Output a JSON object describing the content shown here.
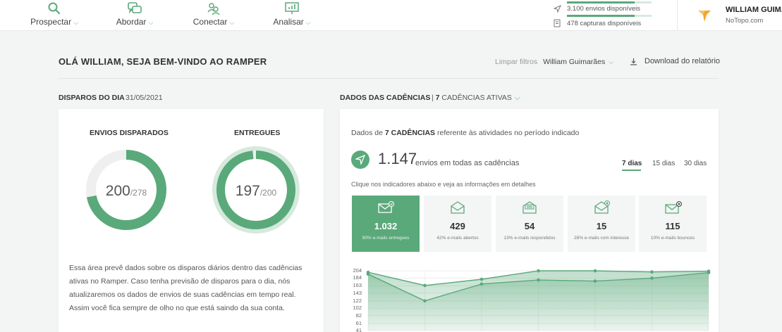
{
  "nav": {
    "items": [
      {
        "label": "Prospectar",
        "icon": "search-icon"
      },
      {
        "label": "Abordar",
        "icon": "chat-icon"
      },
      {
        "label": "Conectar",
        "icon": "people-icon"
      },
      {
        "label": "Analisar",
        "icon": "presentation-chart-icon"
      }
    ]
  },
  "quota": {
    "sends": {
      "text": "3.100 envios disponíveis",
      "icon": "send-icon",
      "fill": 0.8
    },
    "captures": {
      "text": "478 capturas disponíveis",
      "icon": "document-icon",
      "fill": 0.8
    }
  },
  "user": {
    "name": "WILLIAM GUIMA",
    "company": "NoTopo.com"
  },
  "header": {
    "welcome": "OLÁ WILLIAM, SEJA BEM-VINDO AO RAMPER",
    "clear_filters": "Limpar filtros",
    "user_filter": "William Guimarães",
    "download": "Download do relatório"
  },
  "daily": {
    "title": "DISPAROS DO DIA",
    "date": "31/05/2021",
    "fired": {
      "label": "ENVIOS DISPARADOS",
      "value": "200",
      "total": "/278",
      "fraction": 0.7194
    },
    "delivered": {
      "label": "ENTREGUES",
      "value": "197",
      "total": "/200",
      "fraction": 0.985
    },
    "description": "Essa área prevê dados sobre os disparos diários dentro das cadências ativas no Ramper. Caso tenha previsão de disparos para o dia, nós atualizaremos os dados de envios de suas cadências em tempo real. Assim você fica sempre de olho no que está saindo da sua conta."
  },
  "cadences": {
    "title": "DADOS DAS CADÊNCIAS",
    "separator": "|",
    "active_count": "7",
    "active_label": "CADÊNCIAS ATIVAS",
    "intro_prefix": "Dados de ",
    "intro_bold": "7 CADÊNCIAS",
    "intro_suffix": " referente às atividades no período indicado",
    "total": "1.147",
    "total_label": "envios em todas as cadências",
    "periods": [
      "7 dias",
      "15 dias",
      "30 dias"
    ],
    "active_period": "7 dias",
    "hint": "Clique nos indicadores abaixo e veja as informações em detalhes",
    "indicators": [
      {
        "icon": "mail-check-icon",
        "value": "1.032",
        "caption": "90% e-mails entregues",
        "active": true
      },
      {
        "icon": "mail-open-icon",
        "value": "429",
        "caption": "42% e-mails abertos",
        "active": false
      },
      {
        "icon": "mail-reply-icon",
        "value": "54",
        "caption": "13% e-mails respondidos",
        "active": false
      },
      {
        "icon": "mail-thumbs-up-icon",
        "value": "15",
        "caption": "28% e-mails com interesse",
        "active": false
      },
      {
        "icon": "mail-bounce-icon",
        "value": "115",
        "caption": "10% e-mails bounces",
        "active": false
      }
    ]
  },
  "chart_data": {
    "type": "area",
    "x": [
      1,
      2,
      3,
      4,
      5,
      6,
      7
    ],
    "yticks": [
      "204",
      "184",
      "163",
      "143",
      "122",
      "102",
      "82",
      "61",
      "41"
    ],
    "ylim": [
      41,
      204
    ],
    "series": [
      {
        "values": [
          200,
          164,
          181,
          204,
          204,
          201,
          203
        ],
        "color": "#5aa97a"
      },
      {
        "values": [
          195,
          122,
          168,
          179,
          176,
          184,
          199
        ],
        "color": "#5aa97a"
      }
    ]
  },
  "colors": {
    "accent": "#5aa97a",
    "accent_light": "#d6e9dd",
    "orange": "#f5a623"
  }
}
